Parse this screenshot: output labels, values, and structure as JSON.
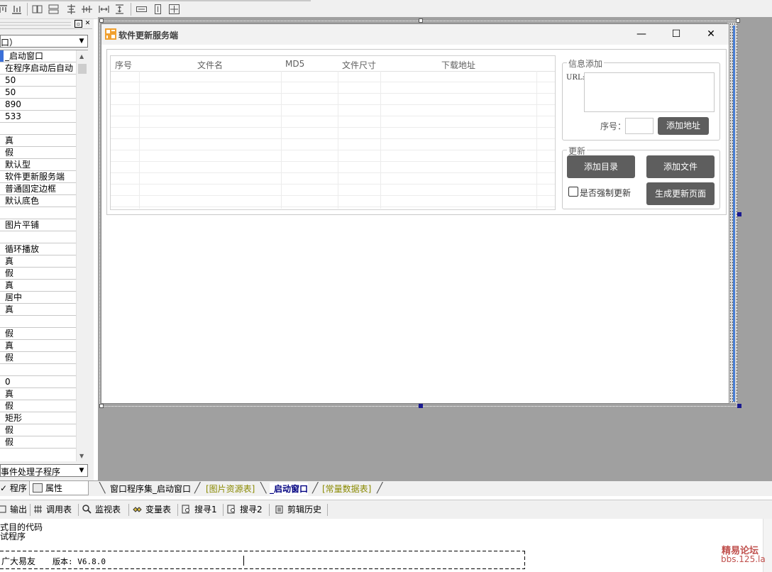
{
  "properties": {
    "object_combo": "口）",
    "rows": [
      "_启动窗口",
      "在程序启动后自动",
      "50",
      "50",
      "890",
      "533",
      "",
      "真",
      "假",
      "默认型",
      "软件更新服务端",
      "普通固定边框",
      "默认底色",
      "",
      "图片平铺",
      "",
      "循环播放",
      "真",
      "假",
      "真",
      "居中",
      "真",
      "",
      "假",
      "真",
      "假",
      "",
      "0",
      "真",
      "假",
      "矩形",
      "假",
      "假"
    ],
    "event_combo": "事件处理子程序",
    "tab_program": "程序",
    "tab_property": "属性"
  },
  "form": {
    "title": "软件更新服务端",
    "minimize": "—",
    "maximize": "☐",
    "close": "✕",
    "list_columns": [
      "序号",
      "文件名",
      "MD5",
      "文件尺寸",
      "下载地址"
    ],
    "info_group": {
      "caption": "信息添加",
      "url_label": "URL:",
      "seq_label": "序号：",
      "add_url_button": "添加地址"
    },
    "update_group": {
      "caption": "更新",
      "add_dir_button": "添加目录",
      "add_file_button": "添加文件",
      "force_update_label": "是否强制更新",
      "gen_page_button": "生成更新页面"
    }
  },
  "doc_tabs": [
    "窗口程序集_启动窗口",
    "[图片资源表]",
    "_启动窗口",
    "[常量数据表]"
  ],
  "bottom_toolbar": [
    "输出",
    "调用表",
    "监视表",
    "变量表",
    "搜寻1",
    "搜寻2",
    "剪辑历史"
  ],
  "output": {
    "line1": "式目的代码",
    "line2": "试程序",
    "line3_left": "广大易友",
    "line3_version": "版本: V6.8.0"
  },
  "watermark": {
    "line1": "精易论坛",
    "line2": "bbs.125.la"
  },
  "colors": {
    "button_dark": "#5e5e5e",
    "selection_blue": "#3a6fd8",
    "watermark_red": "#c0504d",
    "design_gray": "#a0a0a0"
  }
}
